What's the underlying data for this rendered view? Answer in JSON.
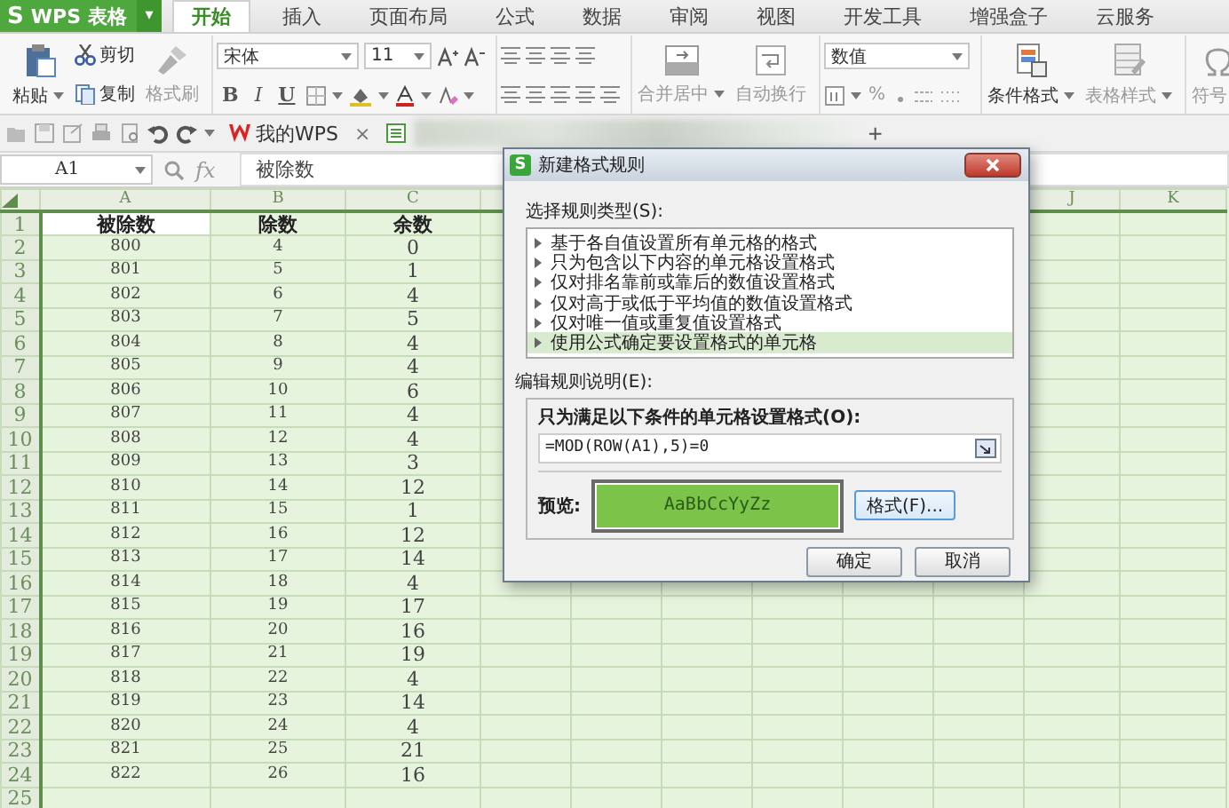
{
  "app": {
    "logo": "S",
    "name": "WPS 表格",
    "caret": "▾"
  },
  "tabs": [
    {
      "label": "开始",
      "selected": true
    },
    {
      "label": "插入",
      "selected": false
    },
    {
      "label": "页面布局",
      "selected": false
    },
    {
      "label": "公式",
      "selected": false
    },
    {
      "label": "数据",
      "selected": false
    },
    {
      "label": "审阅",
      "selected": false
    },
    {
      "label": "视图",
      "selected": false
    },
    {
      "label": "开发工具",
      "selected": false
    },
    {
      "label": "增强盒子",
      "selected": false
    },
    {
      "label": "云服务",
      "selected": false
    }
  ],
  "ribbon": {
    "paste": {
      "label": "粘贴",
      "disabled": false
    },
    "cut": {
      "label": "剪切",
      "disabled": false
    },
    "copy": {
      "label": "复制",
      "disabled": false
    },
    "format_painter": {
      "label": "格式刷",
      "disabled": true
    },
    "font_name": "宋体",
    "font_size": "11",
    "bold": "B",
    "italic": "I",
    "underline": "U",
    "merge": {
      "label": "合并居中",
      "disabled": true
    },
    "wrap": {
      "label": "自动换行",
      "disabled": true
    },
    "number_format": "数值",
    "percent": "%",
    "conditional_format": {
      "label": "条件格式",
      "disabled": false
    },
    "table_style": {
      "label": "表格样式",
      "disabled": true
    },
    "symbol": {
      "label": "符号",
      "disabled": true
    }
  },
  "doc_tabs": [
    {
      "label": "我的WPS",
      "close": "×"
    }
  ],
  "new_tab": "+",
  "formula_bar": {
    "cell": "A1",
    "fx": "fx",
    "value": "被除数"
  },
  "sheet": {
    "columns": [
      "A",
      "B",
      "C",
      "J",
      "K"
    ],
    "rows": [
      {
        "number": "1",
        "cells": [
          {
            "text": "被除数",
            "selected": true
          },
          {
            "text": "除数",
            "selected": false
          },
          {
            "text": "余数",
            "selected": false
          }
        ]
      },
      {
        "number": "2",
        "cells": [
          {
            "text": "800",
            "selected": false
          },
          {
            "text": "4",
            "selected": false
          },
          {
            "text": "0",
            "selected": false
          }
        ]
      },
      {
        "number": "3",
        "cells": [
          {
            "text": "801",
            "selected": false
          },
          {
            "text": "5",
            "selected": false
          },
          {
            "text": "1",
            "selected": false
          }
        ]
      },
      {
        "number": "4",
        "cells": [
          {
            "text": "802",
            "selected": false
          },
          {
            "text": "6",
            "selected": false
          },
          {
            "text": "4",
            "selected": false
          }
        ]
      },
      {
        "number": "5",
        "cells": [
          {
            "text": "803",
            "selected": false
          },
          {
            "text": "7",
            "selected": false
          },
          {
            "text": "5",
            "selected": false
          }
        ]
      },
      {
        "number": "6",
        "cells": [
          {
            "text": "804",
            "selected": false
          },
          {
            "text": "8",
            "selected": false
          },
          {
            "text": "4",
            "selected": false
          }
        ]
      },
      {
        "number": "7",
        "cells": [
          {
            "text": "805",
            "selected": false
          },
          {
            "text": "9",
            "selected": false
          },
          {
            "text": "4",
            "selected": false
          }
        ]
      },
      {
        "number": "8",
        "cells": [
          {
            "text": "806",
            "selected": false
          },
          {
            "text": "10",
            "selected": false
          },
          {
            "text": "6",
            "selected": false
          }
        ]
      },
      {
        "number": "9",
        "cells": [
          {
            "text": "807",
            "selected": false
          },
          {
            "text": "11",
            "selected": false
          },
          {
            "text": "4",
            "selected": false
          }
        ]
      },
      {
        "number": "10",
        "cells": [
          {
            "text": "808",
            "selected": false
          },
          {
            "text": "12",
            "selected": false
          },
          {
            "text": "4",
            "selected": false
          }
        ]
      },
      {
        "number": "11",
        "cells": [
          {
            "text": "809",
            "selected": false
          },
          {
            "text": "13",
            "selected": false
          },
          {
            "text": "3",
            "selected": false
          }
        ]
      },
      {
        "number": "12",
        "cells": [
          {
            "text": "810",
            "selected": false
          },
          {
            "text": "14",
            "selected": false
          },
          {
            "text": "12",
            "selected": false
          }
        ]
      },
      {
        "number": "13",
        "cells": [
          {
            "text": "811",
            "selected": false
          },
          {
            "text": "15",
            "selected": false
          },
          {
            "text": "1",
            "selected": false
          }
        ]
      },
      {
        "number": "14",
        "cells": [
          {
            "text": "812",
            "selected": false
          },
          {
            "text": "16",
            "selected": false
          },
          {
            "text": "12",
            "selected": false
          }
        ]
      },
      {
        "number": "15",
        "cells": [
          {
            "text": "813",
            "selected": false
          },
          {
            "text": "17",
            "selected": false
          },
          {
            "text": "14",
            "selected": false
          }
        ]
      },
      {
        "number": "16",
        "cells": [
          {
            "text": "814",
            "selected": false
          },
          {
            "text": "18",
            "selected": false
          },
          {
            "text": "4",
            "selected": false
          }
        ]
      },
      {
        "number": "17",
        "cells": [
          {
            "text": "815",
            "selected": false
          },
          {
            "text": "19",
            "selected": false
          },
          {
            "text": "17",
            "selected": false
          }
        ]
      },
      {
        "number": "18",
        "cells": [
          {
            "text": "816",
            "selected": false
          },
          {
            "text": "20",
            "selected": false
          },
          {
            "text": "16",
            "selected": false
          }
        ]
      },
      {
        "number": "19",
        "cells": [
          {
            "text": "817",
            "selected": false
          },
          {
            "text": "21",
            "selected": false
          },
          {
            "text": "19",
            "selected": false
          }
        ]
      },
      {
        "number": "20",
        "cells": [
          {
            "text": "818",
            "selected": false
          },
          {
            "text": "22",
            "selected": false
          },
          {
            "text": "4",
            "selected": false
          }
        ]
      },
      {
        "number": "21",
        "cells": [
          {
            "text": "819",
            "selected": false
          },
          {
            "text": "23",
            "selected": false
          },
          {
            "text": "14",
            "selected": false
          }
        ]
      },
      {
        "number": "22",
        "cells": [
          {
            "text": "820",
            "selected": false
          },
          {
            "text": "24",
            "selected": false
          },
          {
            "text": "4",
            "selected": false
          }
        ]
      },
      {
        "number": "23",
        "cells": [
          {
            "text": "821",
            "selected": false
          },
          {
            "text": "25",
            "selected": false
          },
          {
            "text": "21",
            "selected": false
          }
        ]
      },
      {
        "number": "24",
        "cells": [
          {
            "text": "822",
            "selected": false
          },
          {
            "text": "26",
            "selected": false
          },
          {
            "text": "16",
            "selected": false
          }
        ]
      },
      {
        "number": "25",
        "cells": []
      }
    ]
  },
  "dialog": {
    "icon": "S",
    "title": "新建格式规则",
    "rule_type_label": "选择规则类型(S):",
    "rule_types": [
      {
        "label": "基于各自值设置所有单元格的格式",
        "selected": false
      },
      {
        "label": "只为包含以下内容的单元格设置格式",
        "selected": false
      },
      {
        "label": "仅对排名靠前或靠后的数值设置格式",
        "selected": false
      },
      {
        "label": "仅对高于或低于平均值的数值设置格式",
        "selected": false
      },
      {
        "label": "仅对唯一值或重复值设置格式",
        "selected": false
      },
      {
        "label": "使用公式确定要设置格式的单元格",
        "selected": true
      }
    ],
    "edit_label": "编辑规则说明(E):",
    "condition_label": "只为满足以下条件的单元格设置格式(O):",
    "formula": "=MOD(ROW(A1),5)=0",
    "preview_label": "预览:",
    "preview_text": "AaBbCcYyZz",
    "format_button": "格式(F)...",
    "ok": "确定",
    "cancel": "取消"
  }
}
